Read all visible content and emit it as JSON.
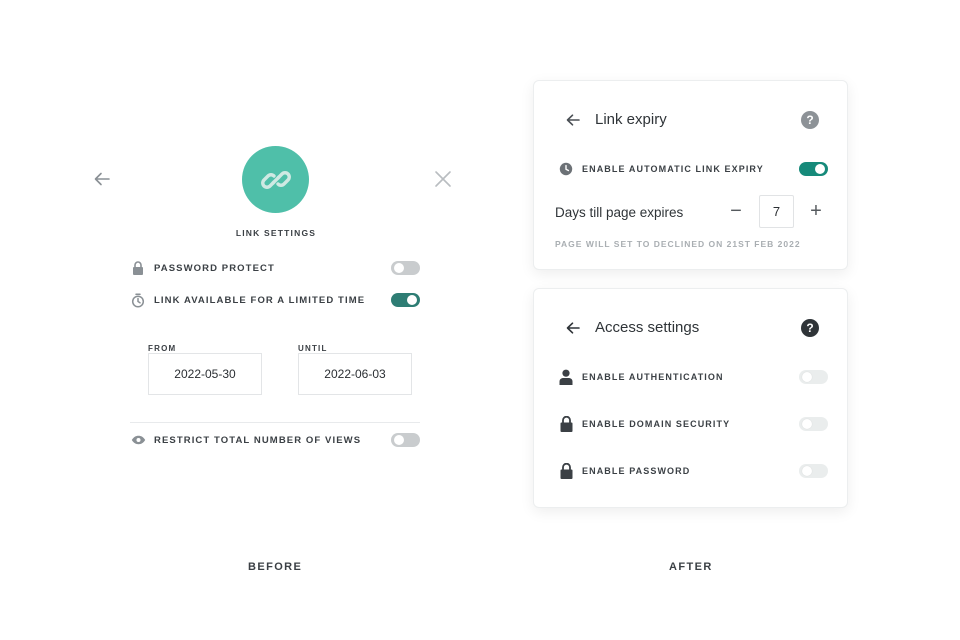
{
  "colors": {
    "accent_teal": "#4fbfa9",
    "toggle_on_before": "#2e7d74",
    "toggle_on_after": "#168a7a",
    "toggle_off": "#c9ccce",
    "text_dark": "#3b4045",
    "text_muted": "#a9aeb2"
  },
  "before": {
    "back_icon": "arrow-left-icon",
    "close_icon": "close-icon",
    "logo_icon": "link-chain-icon",
    "title": "LINK SETTINGS",
    "password_protect": {
      "label": "PASSWORD PROTECT",
      "icon": "lock-icon",
      "enabled": false
    },
    "limited_time": {
      "label": "LINK AVAILABLE FOR A LIMITED TIME",
      "icon": "stopwatch-icon",
      "enabled": true
    },
    "from": {
      "label": "FROM",
      "value": "2022-05-30"
    },
    "until": {
      "label": "UNTIL",
      "value": "2022-06-03"
    },
    "restrict_views": {
      "label": "RESTRICT TOTAL NUMBER OF VIEWS",
      "icon": "eye-icon",
      "enabled": false
    },
    "footer": "BEFORE"
  },
  "after": {
    "link_expiry": {
      "title": "Link expiry",
      "enable_label": "ENABLE AUTOMATIC LINK EXPIRY",
      "icon": "clock-icon",
      "enabled": true,
      "days_label": "Days till page expires",
      "days_value": "7",
      "minus": "−",
      "plus": "+",
      "note": "PAGE WILL SET TO DECLINED ON 21ST FEB 2022"
    },
    "access_settings": {
      "title": "Access settings",
      "items": [
        {
          "label": "ENABLE AUTHENTICATION",
          "icon": "user-icon",
          "enabled": false
        },
        {
          "label": "ENABLE DOMAIN SECURITY",
          "icon": "lock-icon",
          "enabled": false
        },
        {
          "label": "ENABLE PASSWORD",
          "icon": "lock-icon",
          "enabled": false
        }
      ]
    },
    "footer": "AFTER"
  }
}
